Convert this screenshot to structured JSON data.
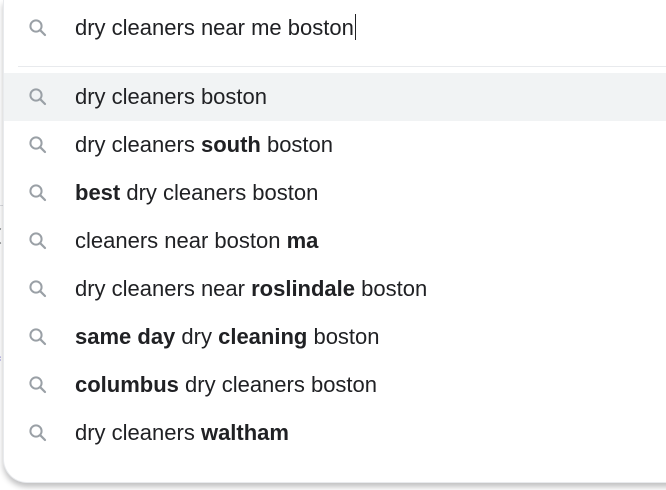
{
  "search": {
    "query": "dry cleaners near me boston",
    "icon": "search-icon"
  },
  "suggestions": [
    {
      "parts": [
        {
          "text": "dry cleaners boston",
          "bold": false
        }
      ]
    },
    {
      "parts": [
        {
          "text": "dry cleaners ",
          "bold": false
        },
        {
          "text": "south",
          "bold": true
        },
        {
          "text": " boston",
          "bold": false
        }
      ]
    },
    {
      "parts": [
        {
          "text": "best",
          "bold": true
        },
        {
          "text": " dry cleaners boston",
          "bold": false
        }
      ]
    },
    {
      "parts": [
        {
          "text": "cleaners near boston ",
          "bold": false
        },
        {
          "text": "ma",
          "bold": true
        }
      ]
    },
    {
      "parts": [
        {
          "text": "dry cleaners near ",
          "bold": false
        },
        {
          "text": "roslindale",
          "bold": true
        },
        {
          "text": " boston",
          "bold": false
        }
      ]
    },
    {
      "parts": [
        {
          "text": "same day",
          "bold": true
        },
        {
          "text": " dry ",
          "bold": false
        },
        {
          "text": "cleaning",
          "bold": true
        },
        {
          "text": " boston",
          "bold": false
        }
      ]
    },
    {
      "parts": [
        {
          "text": "columbus",
          "bold": true
        },
        {
          "text": " dry cleaners boston",
          "bold": false
        }
      ]
    },
    {
      "parts": [
        {
          "text": "dry cleaners ",
          "bold": false
        },
        {
          "text": "waltham",
          "bold": true
        }
      ]
    }
  ],
  "colors": {
    "icon": "#9aa0a6",
    "text": "#202124",
    "highlight": "#f1f3f4"
  }
}
